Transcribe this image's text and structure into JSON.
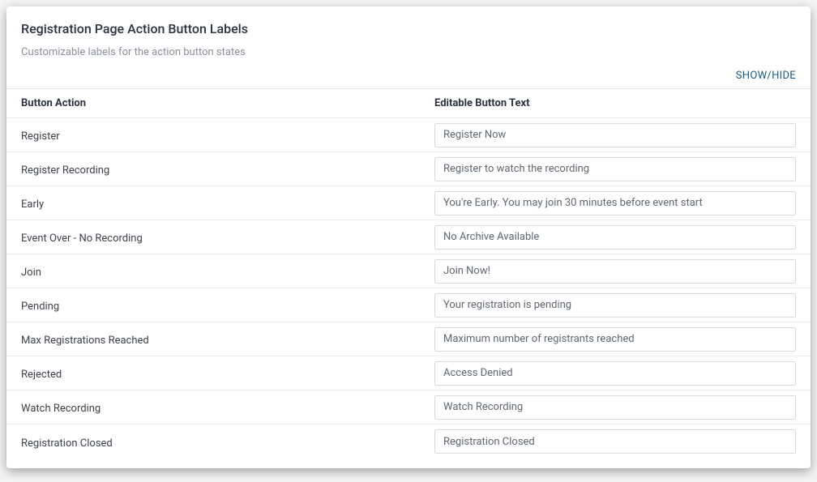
{
  "card": {
    "title": "Registration Page Action Button Labels",
    "subtitle": "Customizable labels for the action button states",
    "show_hide": "SHOW/HIDE"
  },
  "table": {
    "header_left": "Button Action",
    "header_right": "Editable Button Text",
    "rows": [
      {
        "action": "Register",
        "text": "Register Now"
      },
      {
        "action": "Register Recording",
        "text": "Register to watch the recording"
      },
      {
        "action": "Early",
        "text": "You're Early. You may join 30 minutes before event start"
      },
      {
        "action": "Event Over - No Recording",
        "text": "No Archive Available"
      },
      {
        "action": "Join",
        "text": "Join Now!"
      },
      {
        "action": "Pending",
        "text": "Your registration is pending"
      },
      {
        "action": "Max Registrations Reached",
        "text": "Maximum number of registrants reached"
      },
      {
        "action": "Rejected",
        "text": "Access Denied"
      },
      {
        "action": "Watch Recording",
        "text": "Watch Recording"
      },
      {
        "action": "Registration Closed",
        "text": "Registration Closed"
      }
    ]
  }
}
